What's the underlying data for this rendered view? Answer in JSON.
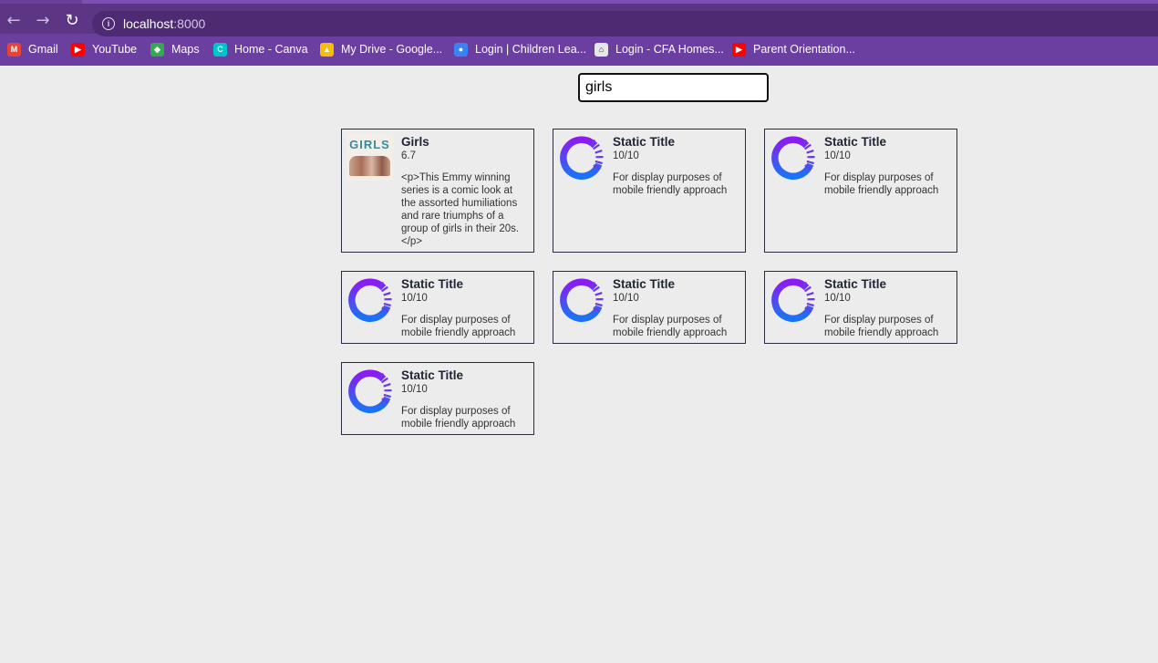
{
  "browser": {
    "url_host": "localhost",
    "url_port": ":8000",
    "bookmarks": [
      {
        "label": "Gmail",
        "color": "#ea4335",
        "glyph": "M",
        "icon": "gmail-icon"
      },
      {
        "label": "YouTube",
        "color": "#ff0000",
        "glyph": "▶",
        "icon": "youtube-icon"
      },
      {
        "label": "Maps",
        "color": "#34a853",
        "glyph": "◆",
        "icon": "maps-icon"
      },
      {
        "label": "Home - Canva",
        "color": "#00c4cc",
        "glyph": "C",
        "icon": "canva-icon"
      },
      {
        "label": "My Drive - Google...",
        "color": "#fbbc04",
        "glyph": "▲",
        "icon": "drive-icon"
      },
      {
        "label": "Login | Children Lea...",
        "color": "#3b82f6",
        "glyph": "●",
        "icon": "children-learning-icon"
      },
      {
        "label": "Login - CFA Homes...",
        "color": "#e5e7eb",
        "glyph": "⌂",
        "icon": "home-icon"
      },
      {
        "label": "Parent Orientation...",
        "color": "#ff0000",
        "glyph": "▶",
        "icon": "youtube-icon"
      }
    ]
  },
  "search": {
    "value": "girls"
  },
  "results": [
    {
      "title": "Girls",
      "rating": "6.7",
      "description": "<p>This Emmy winning series is a comic look at the assorted humiliations and rare triumphs of a group of girls in their 20s.</p>",
      "image": "girls-poster",
      "poster_text": "GIRLS"
    },
    {
      "title": "Static Title",
      "rating": "10/10",
      "description": "For display purposes of mobile friendly approach",
      "image": "spinner-logo"
    },
    {
      "title": "Static Title",
      "rating": "10/10",
      "description": "For display purposes of mobile friendly approach",
      "image": "spinner-logo"
    },
    {
      "title": "Static Title",
      "rating": "10/10",
      "description": "For display purposes of mobile friendly approach",
      "image": "spinner-logo"
    },
    {
      "title": "Static Title",
      "rating": "10/10",
      "description": "For display purposes of mobile friendly approach",
      "image": "spinner-logo"
    },
    {
      "title": "Static Title",
      "rating": "10/10",
      "description": "For display purposes of mobile friendly approach",
      "image": "spinner-logo"
    },
    {
      "title": "Static Title",
      "rating": "10/10",
      "description": "For display purposes of mobile friendly approach",
      "image": "spinner-logo"
    }
  ],
  "colors": {
    "chrome": "#6b3fa0",
    "page_bg": "#ececec",
    "card_border": "#2a2d3e",
    "logo_gradient_start": "#8b1cf0",
    "logo_gradient_end": "#1a73f5"
  }
}
